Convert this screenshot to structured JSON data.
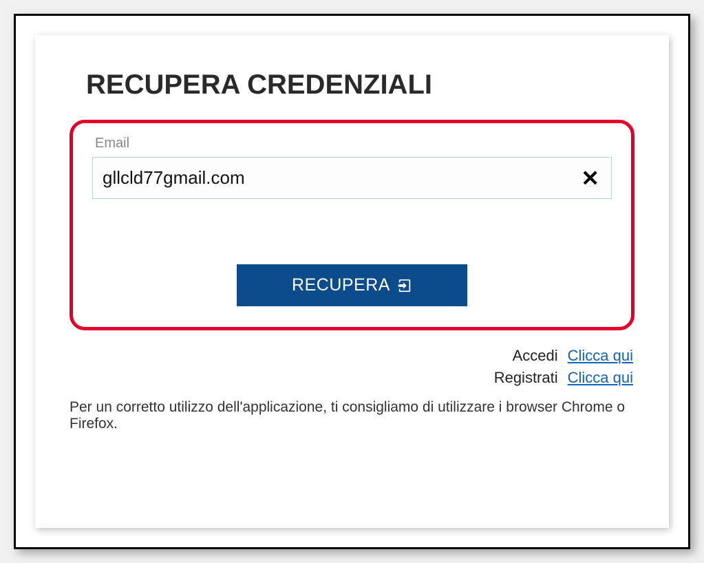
{
  "title": "RECUPERA CREDENZIALI",
  "form": {
    "email_label": "Email",
    "email_value": "gllcld77gmail.com",
    "clear_icon": "✕"
  },
  "button": {
    "label": "RECUPERA"
  },
  "links": {
    "login_label": "Accedi",
    "login_action": "Clicca qui",
    "register_label": "Registrati",
    "register_action": "Clicca qui"
  },
  "footer": "Per un corretto utilizzo dell'applicazione, ti consigliamo di utilizzare i browser Chrome o Firefox."
}
